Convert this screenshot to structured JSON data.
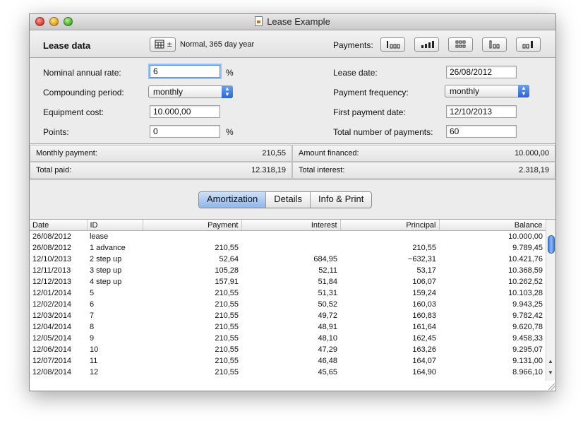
{
  "window": {
    "title": "Lease Example"
  },
  "header": {
    "section_title": "Lease data",
    "day_count": "Normal, 365 day year",
    "payments_label": "Payments:",
    "payment_patterns": [
      "payment-pattern-1",
      "payment-pattern-2",
      "payment-pattern-3",
      "payment-pattern-4",
      "payment-pattern-5"
    ]
  },
  "form": {
    "nominal_rate_label": "Nominal annual rate:",
    "nominal_rate_value": "6",
    "rate_unit": "%",
    "compounding_label": "Compounding period:",
    "compounding_value": "monthly",
    "equipment_cost_label": "Equipment cost:",
    "equipment_cost_value": "10.000,00",
    "points_label": "Points:",
    "points_value": "0",
    "points_unit": "%",
    "lease_date_label": "Lease date:",
    "lease_date_value": "26/08/2012",
    "payment_frequency_label": "Payment frequency:",
    "payment_frequency_value": "monthly",
    "first_payment_label": "First payment date:",
    "first_payment_value": "12/10/2013",
    "total_payments_label": "Total number of payments:",
    "total_payments_value": "60"
  },
  "summary": {
    "monthly_payment_label": "Monthly payment:",
    "monthly_payment_value": "210,55",
    "amount_financed_label": "Amount financed:",
    "amount_financed_value": "10.000,00",
    "total_paid_label": "Total paid:",
    "total_paid_value": "12.318,19",
    "total_interest_label": "Total interest:",
    "total_interest_value": "2.318,19"
  },
  "tabs": [
    "Amortization",
    "Details",
    "Info & Print"
  ],
  "table": {
    "columns": [
      "Date",
      "ID",
      "Payment",
      "Interest",
      "Principal",
      "Balance"
    ],
    "rows": [
      [
        "26/08/2012",
        "lease",
        "",
        "",
        "",
        "10.000,00"
      ],
      [
        "26/08/2012",
        "1 advance",
        "210,55",
        "",
        "210,55",
        "9.789,45"
      ],
      [
        "12/10/2013",
        "2 step up",
        "52,64",
        "684,95",
        "−632,31",
        "10.421,76"
      ],
      [
        "12/11/2013",
        "3 step up",
        "105,28",
        "52,11",
        "53,17",
        "10.368,59"
      ],
      [
        "12/12/2013",
        "4 step up",
        "157,91",
        "51,84",
        "106,07",
        "10.262,52"
      ],
      [
        "12/01/2014",
        "5",
        "210,55",
        "51,31",
        "159,24",
        "10.103,28"
      ],
      [
        "12/02/2014",
        "6",
        "210,55",
        "50,52",
        "160,03",
        "9.943,25"
      ],
      [
        "12/03/2014",
        "7",
        "210,55",
        "49,72",
        "160,83",
        "9.782,42"
      ],
      [
        "12/04/2014",
        "8",
        "210,55",
        "48,91",
        "161,64",
        "9.620,78"
      ],
      [
        "12/05/2014",
        "9",
        "210,55",
        "48,10",
        "162,45",
        "9.458,33"
      ],
      [
        "12/06/2014",
        "10",
        "210,55",
        "47,29",
        "163,26",
        "9.295,07"
      ],
      [
        "12/07/2014",
        "11",
        "210,55",
        "46,48",
        "164,07",
        "9.131,00"
      ],
      [
        "12/08/2014",
        "12",
        "210,55",
        "45,65",
        "164,90",
        "8.966,10"
      ]
    ]
  }
}
